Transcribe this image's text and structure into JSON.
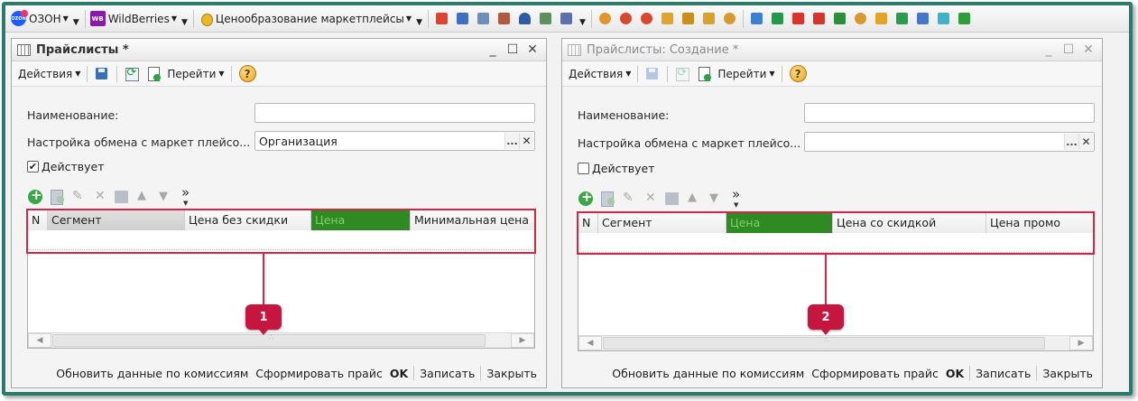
{
  "topbar": {
    "menus": [
      {
        "name": "ozon-menu",
        "label": "ОЗОН",
        "logo_text": "OZON"
      },
      {
        "name": "wildberries-menu",
        "label": "WildBerries",
        "logo_text": "WB"
      },
      {
        "name": "pricing-menu",
        "label": "Ценообразование маркетплейсы"
      }
    ]
  },
  "windows": [
    {
      "title": "Прайслисты *",
      "commands": {
        "actions": "Действия",
        "goto": "Перейти",
        "help": "?"
      },
      "form": {
        "name_label": "Наименование:",
        "name_value": "",
        "exchange_label": "Настройка обмена с маркет плейсо...",
        "exchange_value": "Организация",
        "active_label": "Действует",
        "active_checked": true,
        "active_mark": "✔"
      },
      "grid": {
        "columns": [
          "N",
          "Сегмент",
          "Цена без скидки",
          "Цена",
          "Минимальная цена"
        ]
      },
      "badge": "1",
      "footer": {
        "update": "Обновить данные по комиссиям",
        "generate": "Сформировать прайс",
        "ok": "OK",
        "save": "Записать",
        "close": "Закрыть"
      }
    },
    {
      "title": "Прайслисты: Создание *",
      "commands": {
        "actions": "Действия",
        "goto": "Перейти",
        "help": "?"
      },
      "form": {
        "name_label": "Наименование:",
        "name_value": "",
        "exchange_label": "Настройка обмена с маркет плейсо...",
        "exchange_value": "",
        "active_label": "Действует",
        "active_checked": false,
        "active_mark": ""
      },
      "grid": {
        "columns": [
          "N",
          "Сегмент",
          "Цена",
          "Цена со скидкой",
          "Цена промо"
        ]
      },
      "badge": "2",
      "footer": {
        "update": "Обновить данные по комиссиям",
        "generate": "Сформировать прайс",
        "ok": "OK",
        "save": "Записать",
        "close": "Закрыть"
      }
    }
  ],
  "colors": {
    "frame": "#2c7a6c",
    "highlight": "#d3244a",
    "badge": "#c6163f",
    "price_column": "#2f8a24"
  }
}
